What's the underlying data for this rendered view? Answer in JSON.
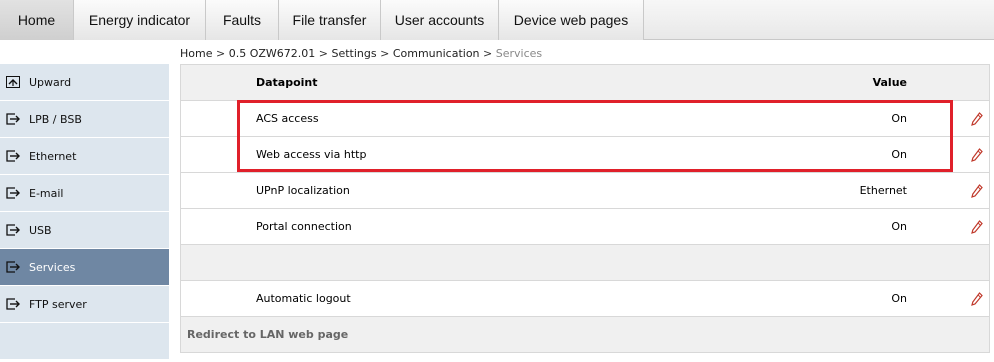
{
  "tabs": [
    {
      "label": "Home",
      "active": true
    },
    {
      "label": "Energy indicator",
      "active": false
    },
    {
      "label": "Faults",
      "active": false
    },
    {
      "label": "File transfer",
      "active": false
    },
    {
      "label": "User accounts",
      "active": false
    },
    {
      "label": "Device web pages",
      "active": false
    }
  ],
  "breadcrumb": {
    "home": "Home",
    "device": "0.5 OZW672.01",
    "settings": "Settings",
    "communication": "Communication",
    "current": "Services",
    "separator": ">"
  },
  "sidebar": {
    "items": [
      {
        "label": "Upward",
        "icon": "upward-icon",
        "active": false
      },
      {
        "label": "LPB / BSB",
        "icon": "arrow-box-icon",
        "active": false
      },
      {
        "label": "Ethernet",
        "icon": "arrow-box-icon",
        "active": false
      },
      {
        "label": "E-mail",
        "icon": "arrow-box-icon",
        "active": false
      },
      {
        "label": "USB",
        "icon": "arrow-box-icon",
        "active": false
      },
      {
        "label": "Services",
        "icon": "arrow-box-icon",
        "active": true
      },
      {
        "label": "FTP server",
        "icon": "arrow-box-icon",
        "active": false
      }
    ]
  },
  "table": {
    "headers": {
      "datapoint": "Datapoint",
      "value": "Value"
    },
    "rows": [
      {
        "datapoint": "ACS access",
        "value": "On"
      },
      {
        "datapoint": "Web access via http",
        "value": "On"
      },
      {
        "datapoint": "UPnP localization",
        "value": "Ethernet"
      },
      {
        "datapoint": "Portal connection",
        "value": "On"
      },
      {
        "datapoint": "Automatic logout",
        "value": "On"
      }
    ],
    "redirect_label": "Redirect to LAN web page"
  },
  "colors": {
    "highlight": "#e0202a",
    "sidebar_active": "#6f87a3",
    "sidebar_bg": "#dde6ee",
    "edit_icon": "#c0392b"
  }
}
